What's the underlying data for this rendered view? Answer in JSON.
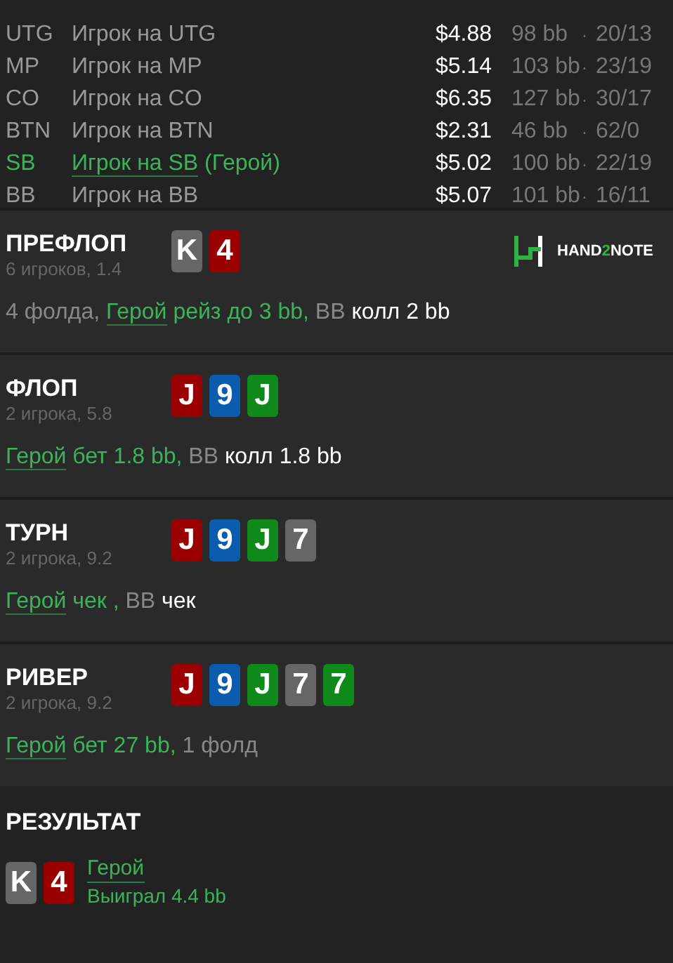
{
  "players": [
    {
      "position": "UTG",
      "name": "Игрок на UTG",
      "hero": false,
      "stack": "$4.88",
      "bb": "98 bb",
      "separator": "·",
      "stats": "20/13"
    },
    {
      "position": "MP",
      "name": "Игрок на MP",
      "hero": false,
      "stack": "$5.14",
      "bb": "103 bb",
      "separator": "·",
      "stats": "23/19"
    },
    {
      "position": "CO",
      "name": "Игрок на CO",
      "hero": false,
      "stack": "$6.35",
      "bb": "127 bb",
      "separator": "·",
      "stats": "30/17"
    },
    {
      "position": "BTN",
      "name": "Игрок на BTN",
      "hero": false,
      "stack": "$2.31",
      "bb": "46 bb",
      "separator": "·",
      "stats": "62/0"
    },
    {
      "position": "SB",
      "name": "Игрок на SB",
      "hero": true,
      "hero_tag": "(Герой)",
      "stack": "$5.02",
      "bb": "100 bb",
      "separator": "·",
      "stats": "22/19"
    },
    {
      "position": "BB",
      "name": "Игрок на BB",
      "hero": false,
      "stack": "$5.07",
      "bb": "101 bb",
      "separator": "·",
      "stats": "16/11"
    }
  ],
  "logo": {
    "prefix": "HAND",
    "accent": "2",
    "suffix": "NOTE"
  },
  "streets": [
    {
      "title": "ПРЕФЛОП",
      "subtitle": "6 игроков, 1.4",
      "logo": true,
      "cards": [
        {
          "rank": "K",
          "color": "#666666"
        },
        {
          "rank": "4",
          "color": "#9b0000"
        }
      ],
      "actions": [
        {
          "kind": "muted",
          "text": "4 фолда, "
        },
        {
          "kind": "hero_link",
          "text": "Герой"
        },
        {
          "kind": "hero",
          "text": " рейз до 3 bb,"
        },
        {
          "kind": "muted",
          "text": " BB"
        },
        {
          "kind": "action",
          "text": " колл 2 bb"
        }
      ]
    },
    {
      "title": "ФЛОП",
      "subtitle": "2 игрока, 5.8",
      "logo": false,
      "cards": [
        {
          "rank": "J",
          "color": "#9b0000"
        },
        {
          "rank": "9",
          "color": "#0b5cad"
        },
        {
          "rank": "J",
          "color": "#0f8a1a"
        }
      ],
      "actions": [
        {
          "kind": "hero_link",
          "text": "Герой"
        },
        {
          "kind": "hero",
          "text": " бет 1.8 bb,"
        },
        {
          "kind": "muted",
          "text": " BB"
        },
        {
          "kind": "action",
          "text": " колл 1.8 bb"
        }
      ]
    },
    {
      "title": "ТУРН",
      "subtitle": "2 игрока, 9.2",
      "logo": false,
      "cards": [
        {
          "rank": "J",
          "color": "#9b0000"
        },
        {
          "rank": "9",
          "color": "#0b5cad"
        },
        {
          "rank": "J",
          "color": "#0f8a1a"
        },
        {
          "rank": "7",
          "color": "#666666"
        }
      ],
      "actions": [
        {
          "kind": "hero_link",
          "text": "Герой"
        },
        {
          "kind": "hero",
          "text": " чек ,"
        },
        {
          "kind": "muted",
          "text": " BB"
        },
        {
          "kind": "action",
          "text": " чек"
        }
      ]
    },
    {
      "title": "РИВЕР",
      "subtitle": "2 игрока, 9.2",
      "logo": false,
      "cards": [
        {
          "rank": "J",
          "color": "#9b0000"
        },
        {
          "rank": "9",
          "color": "#0b5cad"
        },
        {
          "rank": "J",
          "color": "#0f8a1a"
        },
        {
          "rank": "7",
          "color": "#666666"
        },
        {
          "rank": "7",
          "color": "#0f8a1a"
        }
      ],
      "actions": [
        {
          "kind": "hero_link",
          "text": "Герой"
        },
        {
          "kind": "hero",
          "text": " бет 27 bb,"
        },
        {
          "kind": "muted",
          "text": " 1 фолд"
        }
      ]
    }
  ],
  "result": {
    "title": "РЕЗУЛЬТАТ",
    "cards": [
      {
        "rank": "K",
        "color": "#666666"
      },
      {
        "rank": "4",
        "color": "#9b0000"
      }
    ],
    "winner": "Герой",
    "outcome": "Выиграл 4.4 bb"
  }
}
